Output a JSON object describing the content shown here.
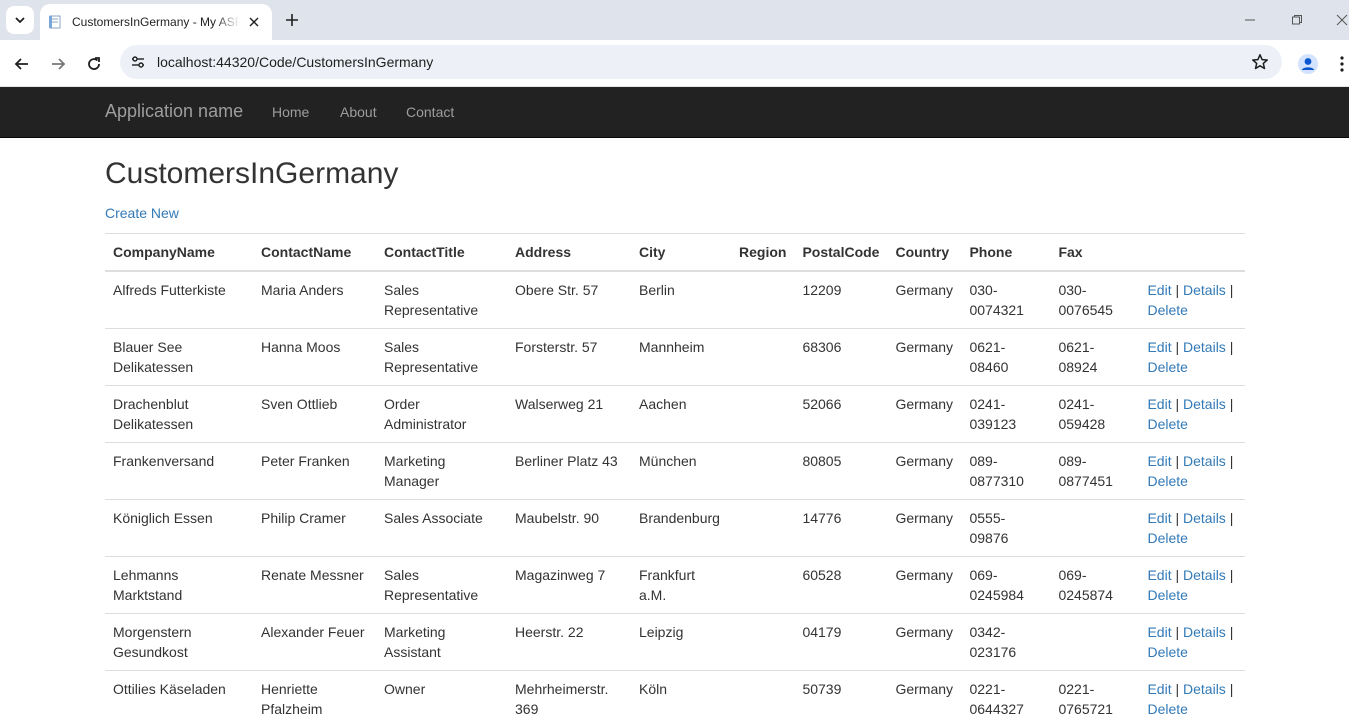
{
  "browser": {
    "tab_title": "CustomersInGermany - My ASP.NET Application",
    "url": "localhost:44320/Code/CustomersInGermany"
  },
  "site": {
    "brand": "Application name",
    "nav": [
      "Home",
      "About",
      "Contact"
    ]
  },
  "page": {
    "title": "CustomersInGermany",
    "create_new": "Create New"
  },
  "table": {
    "headers": [
      "CompanyName",
      "ContactName",
      "ContactTitle",
      "Address",
      "City",
      "Region",
      "PostalCode",
      "Country",
      "Phone",
      "Fax"
    ],
    "actions": {
      "edit": "Edit",
      "details": "Details",
      "delete": "Delete",
      "separator": "|"
    },
    "rows": [
      [
        "Alfreds Futterkiste",
        "Maria Anders",
        "Sales Representative",
        "Obere Str. 57",
        "Berlin",
        "",
        "12209",
        "Germany",
        "030-0074321",
        "030-0076545"
      ],
      [
        "Blauer See Delikatessen",
        "Hanna Moos",
        "Sales Representative",
        "Forsterstr. 57",
        "Mannheim",
        "",
        "68306",
        "Germany",
        "0621-08460",
        "0621-08924"
      ],
      [
        "Drachenblut Delikatessen",
        "Sven Ottlieb",
        "Order Administrator",
        "Walserweg 21",
        "Aachen",
        "",
        "52066",
        "Germany",
        "0241-039123",
        "0241-059428"
      ],
      [
        "Frankenversand",
        "Peter Franken",
        "Marketing Manager",
        "Berliner Platz 43",
        "München",
        "",
        "80805",
        "Germany",
        "089-0877310",
        "089-0877451"
      ],
      [
        "Königlich Essen",
        "Philip Cramer",
        "Sales Associate",
        "Maubelstr. 90",
        "Brandenburg",
        "",
        "14776",
        "Germany",
        "0555-09876",
        ""
      ],
      [
        "Lehmanns Marktstand",
        "Renate Messner",
        "Sales Representative",
        "Magazinweg 7",
        "Frankfurt a.M.",
        "",
        "60528",
        "Germany",
        "069-0245984",
        "069-0245874"
      ],
      [
        "Morgenstern Gesundkost",
        "Alexander Feuer",
        "Marketing Assistant",
        "Heerstr. 22",
        "Leipzig",
        "",
        "04179",
        "Germany",
        "0342-023176",
        ""
      ],
      [
        "Ottilies Käseladen",
        "Henriette Pfalzheim",
        "Owner",
        "Mehrheimerstr. 369",
        "Köln",
        "",
        "50739",
        "Germany",
        "0221-0644327",
        "0221-0765721"
      ]
    ]
  },
  "icons": {
    "tab_list": "chevron-down-icon",
    "favicon": "page-icon",
    "tab_close": "close-icon",
    "new_tab": "plus-icon",
    "back": "arrow-left-icon",
    "forward": "arrow-right-icon",
    "reload": "reload-icon",
    "site_info": "tune-icon",
    "bookmark": "star-icon",
    "profile": "profile-icon",
    "menu": "kebab-menu-icon"
  },
  "colors": {
    "navbar_bg": "#222222",
    "link": "#337ab7",
    "chrome_tabbar": "#dfe3eb",
    "omnibox": "#edf1f7"
  }
}
